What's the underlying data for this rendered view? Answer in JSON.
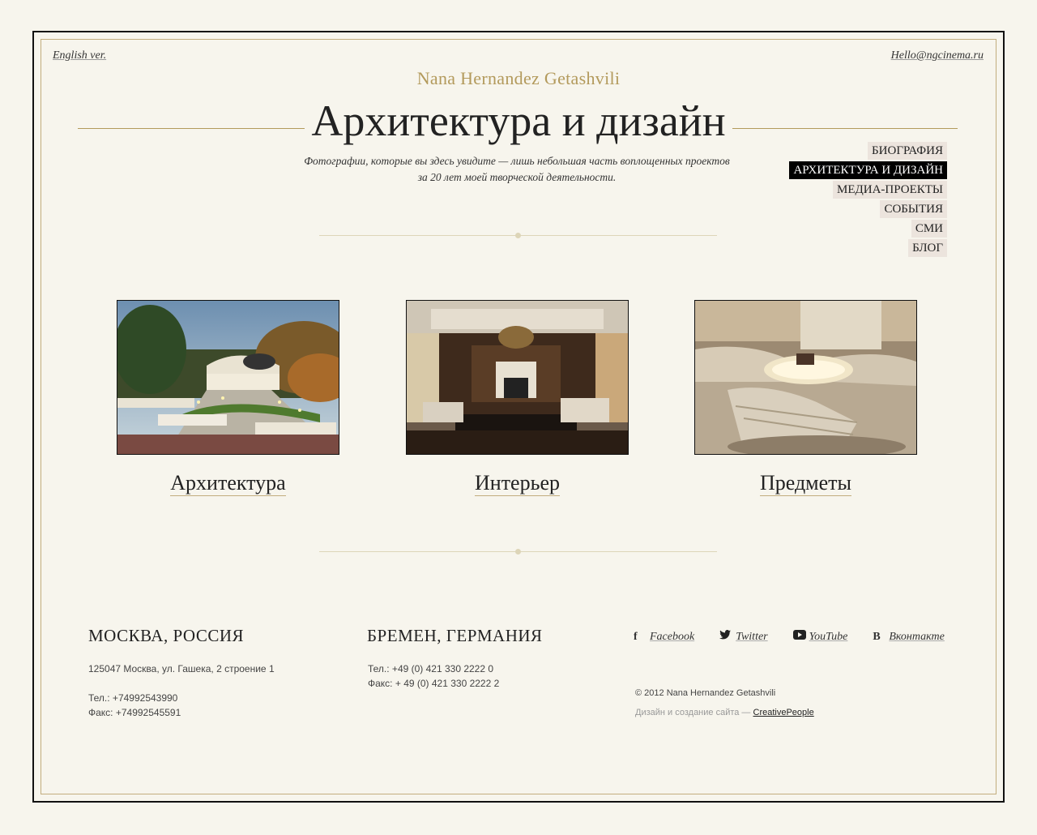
{
  "header": {
    "lang_link": "English ver.",
    "email": "Hello@ngcinema.ru",
    "brand": "Nana Hernandez Getashvili",
    "title": "Архитектура и дизайн",
    "subtitle_line1": "Фотографии, которые вы здесь увидите — лишь небольшая часть воплощенных проектов",
    "subtitle_line2": "за 20 лет моей творческой деятельности."
  },
  "nav": {
    "items": [
      {
        "label": "БИОГРАФИЯ",
        "active": false
      },
      {
        "label": "АРХИТЕКТУРА И ДИЗАЙН",
        "active": true
      },
      {
        "label": "МЕДИА-ПРОЕКТЫ",
        "active": false
      },
      {
        "label": "СОБЫТИЯ",
        "active": false
      },
      {
        "label": "СМИ",
        "active": false
      },
      {
        "label": "БЛОГ",
        "active": false
      }
    ]
  },
  "categories": [
    {
      "label": "Архитектура"
    },
    {
      "label": "Интерьер"
    },
    {
      "label": "Предметы"
    }
  ],
  "footer": {
    "moscow": {
      "city": "МОСКВА, РОССИЯ",
      "address": "125047 Москва, ул. Гашека, 2 строение 1",
      "phone": "Тел.: +74992543990",
      "fax": "Факс: +74992545591"
    },
    "bremen": {
      "city": "БРЕМЕН, ГЕРМАНИЯ",
      "phone": "Тел.: +49 (0) 421 330 2222 0",
      "fax": "Факс: + 49 (0) 421 330 2222 2"
    },
    "social": [
      {
        "label": "Facebook",
        "icon": "facebook-icon"
      },
      {
        "label": "Twitter",
        "icon": "twitter-icon"
      },
      {
        "label": "YouTube",
        "icon": "youtube-icon"
      },
      {
        "label": "Вконтакте",
        "icon": "vk-icon"
      }
    ],
    "copyright": "© 2012 Nana Hernandez Getashvili",
    "credit_prefix": "Дизайн и создание сайта — ",
    "credit_link": "CreativePeople"
  },
  "colors": {
    "background": "#f7f5ed",
    "accent_gold": "#b39a5c",
    "nav_active_bg": "#000000"
  }
}
